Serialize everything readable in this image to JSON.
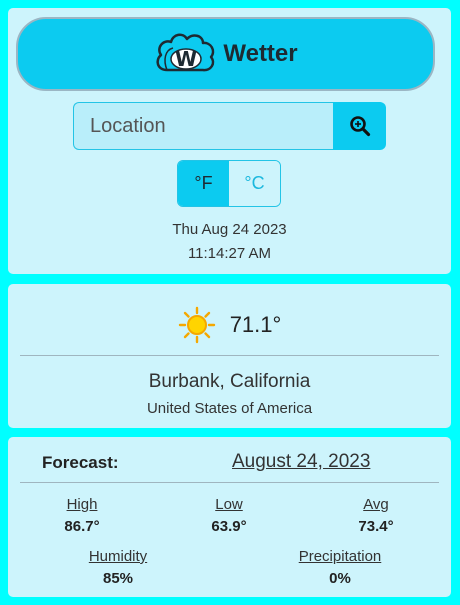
{
  "header": {
    "title": "Wetter",
    "logo_letter": "W",
    "icon": "cloud-logo-icon",
    "colors": {
      "accent": "#0ccbf0",
      "card": "#cdf4fc",
      "page": "#00ffff"
    }
  },
  "search": {
    "placeholder": "Location",
    "value": "",
    "button_icon": "search-icon"
  },
  "units": {
    "fahrenheit_label": "°F",
    "celsius_label": "°C",
    "selected": "fahrenheit"
  },
  "datetime": {
    "date": "Thu Aug 24 2023",
    "time": "11:14:27 AM"
  },
  "current": {
    "weather_icon": "sun-icon",
    "temperature": "71.1°",
    "city": "Burbank, California",
    "country": "United States of America"
  },
  "forecast": {
    "label": "Forecast:",
    "date": "August 24, 2023",
    "high_label": "High",
    "high_value": "86.7°",
    "low_label": "Low",
    "low_value": "63.9°",
    "avg_label": "Avg",
    "avg_value": "73.4°",
    "humidity_label": "Humidity",
    "humidity_value": "85%",
    "precipitation_label": "Precipitation",
    "precipitation_value": "0%"
  }
}
